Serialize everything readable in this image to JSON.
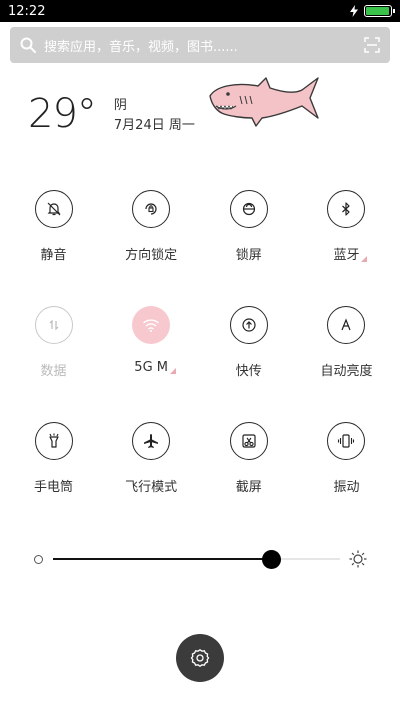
{
  "status_bar": {
    "time": "12:22",
    "battery_level": 0.95,
    "icons": [
      "charging-icon",
      "battery-icon"
    ]
  },
  "search": {
    "placeholder": "搜索应用，音乐，视频，图书......"
  },
  "weather": {
    "temperature": "29°",
    "condition": "阴",
    "date": "7月24日 周一"
  },
  "toggles": [
    {
      "id": "mute",
      "label": "静音",
      "icon": "bell-off-icon",
      "state": "off"
    },
    {
      "id": "rotation-lock",
      "label": "方向锁定",
      "icon": "rotation-lock-icon",
      "state": "off"
    },
    {
      "id": "lock-screen",
      "label": "锁屏",
      "icon": "lock-icon",
      "state": "off"
    },
    {
      "id": "bluetooth",
      "label": "蓝牙",
      "icon": "bluetooth-icon",
      "state": "off",
      "has_more": true
    },
    {
      "id": "mobile-data",
      "label": "数据",
      "icon": "data-arrows-icon",
      "state": "disabled"
    },
    {
      "id": "wlan",
      "label": "5G  M",
      "icon": "wifi-icon",
      "state": "on",
      "has_more": true
    },
    {
      "id": "quick-share",
      "label": "快传",
      "icon": "quick-share-icon",
      "state": "off"
    },
    {
      "id": "auto-brightness",
      "label": "自动亮度",
      "icon": "auto-brightness-icon",
      "state": "off"
    },
    {
      "id": "flashlight",
      "label": "手电筒",
      "icon": "flashlight-icon",
      "state": "off"
    },
    {
      "id": "airplane-mode",
      "label": "飞行模式",
      "icon": "airplane-icon",
      "state": "off"
    },
    {
      "id": "screenshot",
      "label": "截屏",
      "icon": "scissors-icon",
      "state": "off"
    },
    {
      "id": "vibrate",
      "label": "振动",
      "icon": "vibrate-icon",
      "state": "off"
    }
  ],
  "brightness": {
    "level": 0.76
  },
  "colors": {
    "accent_active": "#f7c8cd",
    "status_bar_bg": "#000000",
    "search_bg": "#cfcfcf",
    "fab_bg": "#3b3b3b"
  },
  "fab": {
    "icon": "gear-icon"
  }
}
